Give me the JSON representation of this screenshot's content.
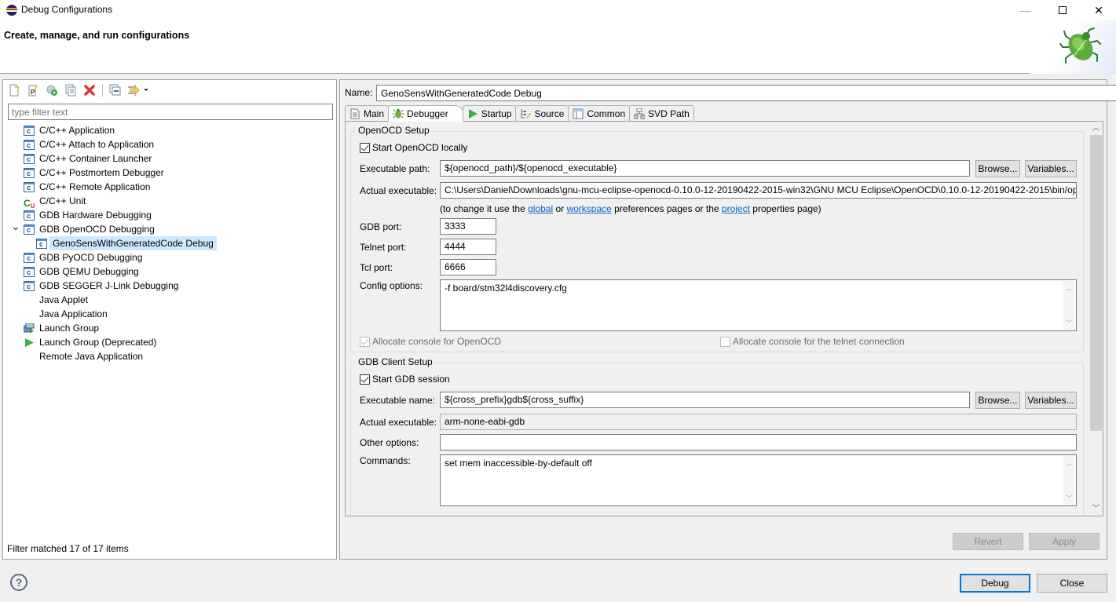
{
  "window": {
    "title": "Debug Configurations",
    "minimize_icon": "minimize-icon",
    "maximize_icon": "maximize-icon",
    "close_icon": "close-icon"
  },
  "header": {
    "heading": "Create, manage, and run configurations",
    "banner_icon": "bug-icon"
  },
  "left": {
    "toolbar": [
      {
        "name": "new-configuration-button",
        "icon": "new-config-icon",
        "tooltip": "New launch configuration"
      },
      {
        "name": "new-prototype-button",
        "icon": "new-prototype-icon",
        "tooltip": "New prototype"
      },
      {
        "name": "export-button",
        "icon": "export-icon",
        "tooltip": "Export"
      },
      {
        "name": "duplicate-button",
        "icon": "duplicate-icon",
        "tooltip": "Duplicate"
      },
      {
        "name": "delete-button",
        "icon": "delete-icon",
        "tooltip": "Delete"
      },
      {
        "name": "collapse-all-button",
        "icon": "collapse-all-icon",
        "tooltip": "Collapse All"
      },
      {
        "name": "filter-button",
        "icon": "filter-icon",
        "tooltip": "Filter"
      }
    ],
    "filter_placeholder": "type filter text",
    "filter_value": "",
    "tree": [
      {
        "label": "C/C++ Application",
        "icon": "c-icon"
      },
      {
        "label": "C/C++ Attach to Application",
        "icon": "c-icon"
      },
      {
        "label": "C/C++ Container Launcher",
        "icon": "c-icon"
      },
      {
        "label": "C/C++ Postmortem Debugger",
        "icon": "c-icon"
      },
      {
        "label": "C/C++ Remote Application",
        "icon": "c-icon"
      },
      {
        "label": "C/C++ Unit",
        "icon": "cunit-icon"
      },
      {
        "label": "GDB Hardware Debugging",
        "icon": "c-icon"
      },
      {
        "label": "GDB OpenOCD Debugging",
        "icon": "c-icon",
        "expanded": true
      },
      {
        "label": "GenoSensWithGeneratedCode Debug",
        "icon": "c-icon",
        "child": true,
        "selected": true
      },
      {
        "label": "GDB PyOCD Debugging",
        "icon": "c-icon"
      },
      {
        "label": "GDB QEMU Debugging",
        "icon": "c-icon"
      },
      {
        "label": "GDB SEGGER J-Link Debugging",
        "icon": "c-icon"
      },
      {
        "label": "Java Applet",
        "icon": ""
      },
      {
        "label": "Java Application",
        "icon": ""
      },
      {
        "label": "Launch Group",
        "icon": "launch-group-icon"
      },
      {
        "label": "Launch Group (Deprecated)",
        "icon": "run-icon"
      },
      {
        "label": "Remote Java Application",
        "icon": ""
      }
    ],
    "status": "Filter matched 17 of 17 items"
  },
  "right": {
    "name_label": "Name:",
    "name_value": "GenoSensWithGeneratedCode Debug",
    "tabs": [
      {
        "label": "Main",
        "icon": "main-tab-icon",
        "active": false
      },
      {
        "label": "Debugger",
        "icon": "debugger-tab-icon",
        "active": true
      },
      {
        "label": "Startup",
        "icon": "startup-tab-icon",
        "active": false
      },
      {
        "label": "Source",
        "icon": "source-tab-icon",
        "active": false
      },
      {
        "label": "Common",
        "icon": "common-tab-icon",
        "active": false
      },
      {
        "label": "SVD Path",
        "icon": "svd-tab-icon",
        "active": false
      }
    ],
    "openocd": {
      "group_title": "OpenOCD Setup",
      "start_locally_label": "Start OpenOCD locally",
      "start_locally_checked": true,
      "exe_path_label": "Executable path:",
      "exe_path_value": "${openocd_path}/${openocd_executable}",
      "browse_label": "Browse...",
      "variables_label": "Variables...",
      "actual_exe_label": "Actual executable:",
      "actual_exe_value": "C:\\Users\\Daniel\\Downloads\\gnu-mcu-eclipse-openocd-0.10.0-12-20190422-2015-win32\\GNU MCU Eclipse\\OpenOCD\\0.10.0-12-20190422-2015\\bin/ope",
      "hint_prefix": "(to change it use the ",
      "hint_global": "global",
      "hint_or": " or ",
      "hint_workspace": "workspace",
      "hint_mid": " preferences pages or the ",
      "hint_project": "project",
      "hint_suffix": " properties page)",
      "gdb_port_label": "GDB port:",
      "gdb_port_value": "3333",
      "telnet_port_label": "Telnet port:",
      "telnet_port_value": "4444",
      "tcl_port_label": "Tcl port:",
      "tcl_port_value": "6666",
      "config_label": "Config options:",
      "config_value": "-f board/stm32l4discovery.cfg",
      "alloc_console_label": "Allocate console for OpenOCD",
      "alloc_console_checked": true,
      "alloc_telnet_label": "Allocate console for the telnet connection",
      "alloc_telnet_checked": false
    },
    "gdb": {
      "group_title": "GDB Client Setup",
      "start_session_label": "Start GDB session",
      "start_session_checked": true,
      "exe_name_label": "Executable name:",
      "exe_name_value": "${cross_prefix}gdb${cross_suffix}",
      "browse_label": "Browse...",
      "variables_label": "Variables...",
      "actual_exe_label": "Actual executable:",
      "actual_exe_value": "arm-none-eabi-gdb",
      "other_options_label": "Other options:",
      "other_options_value": "",
      "commands_label": "Commands:",
      "commands_value": "set mem inaccessible-by-default off"
    },
    "revert_label": "Revert",
    "apply_label": "Apply"
  },
  "footer": {
    "help_icon": "help-icon",
    "debug_label": "Debug",
    "close_label": "Close"
  }
}
